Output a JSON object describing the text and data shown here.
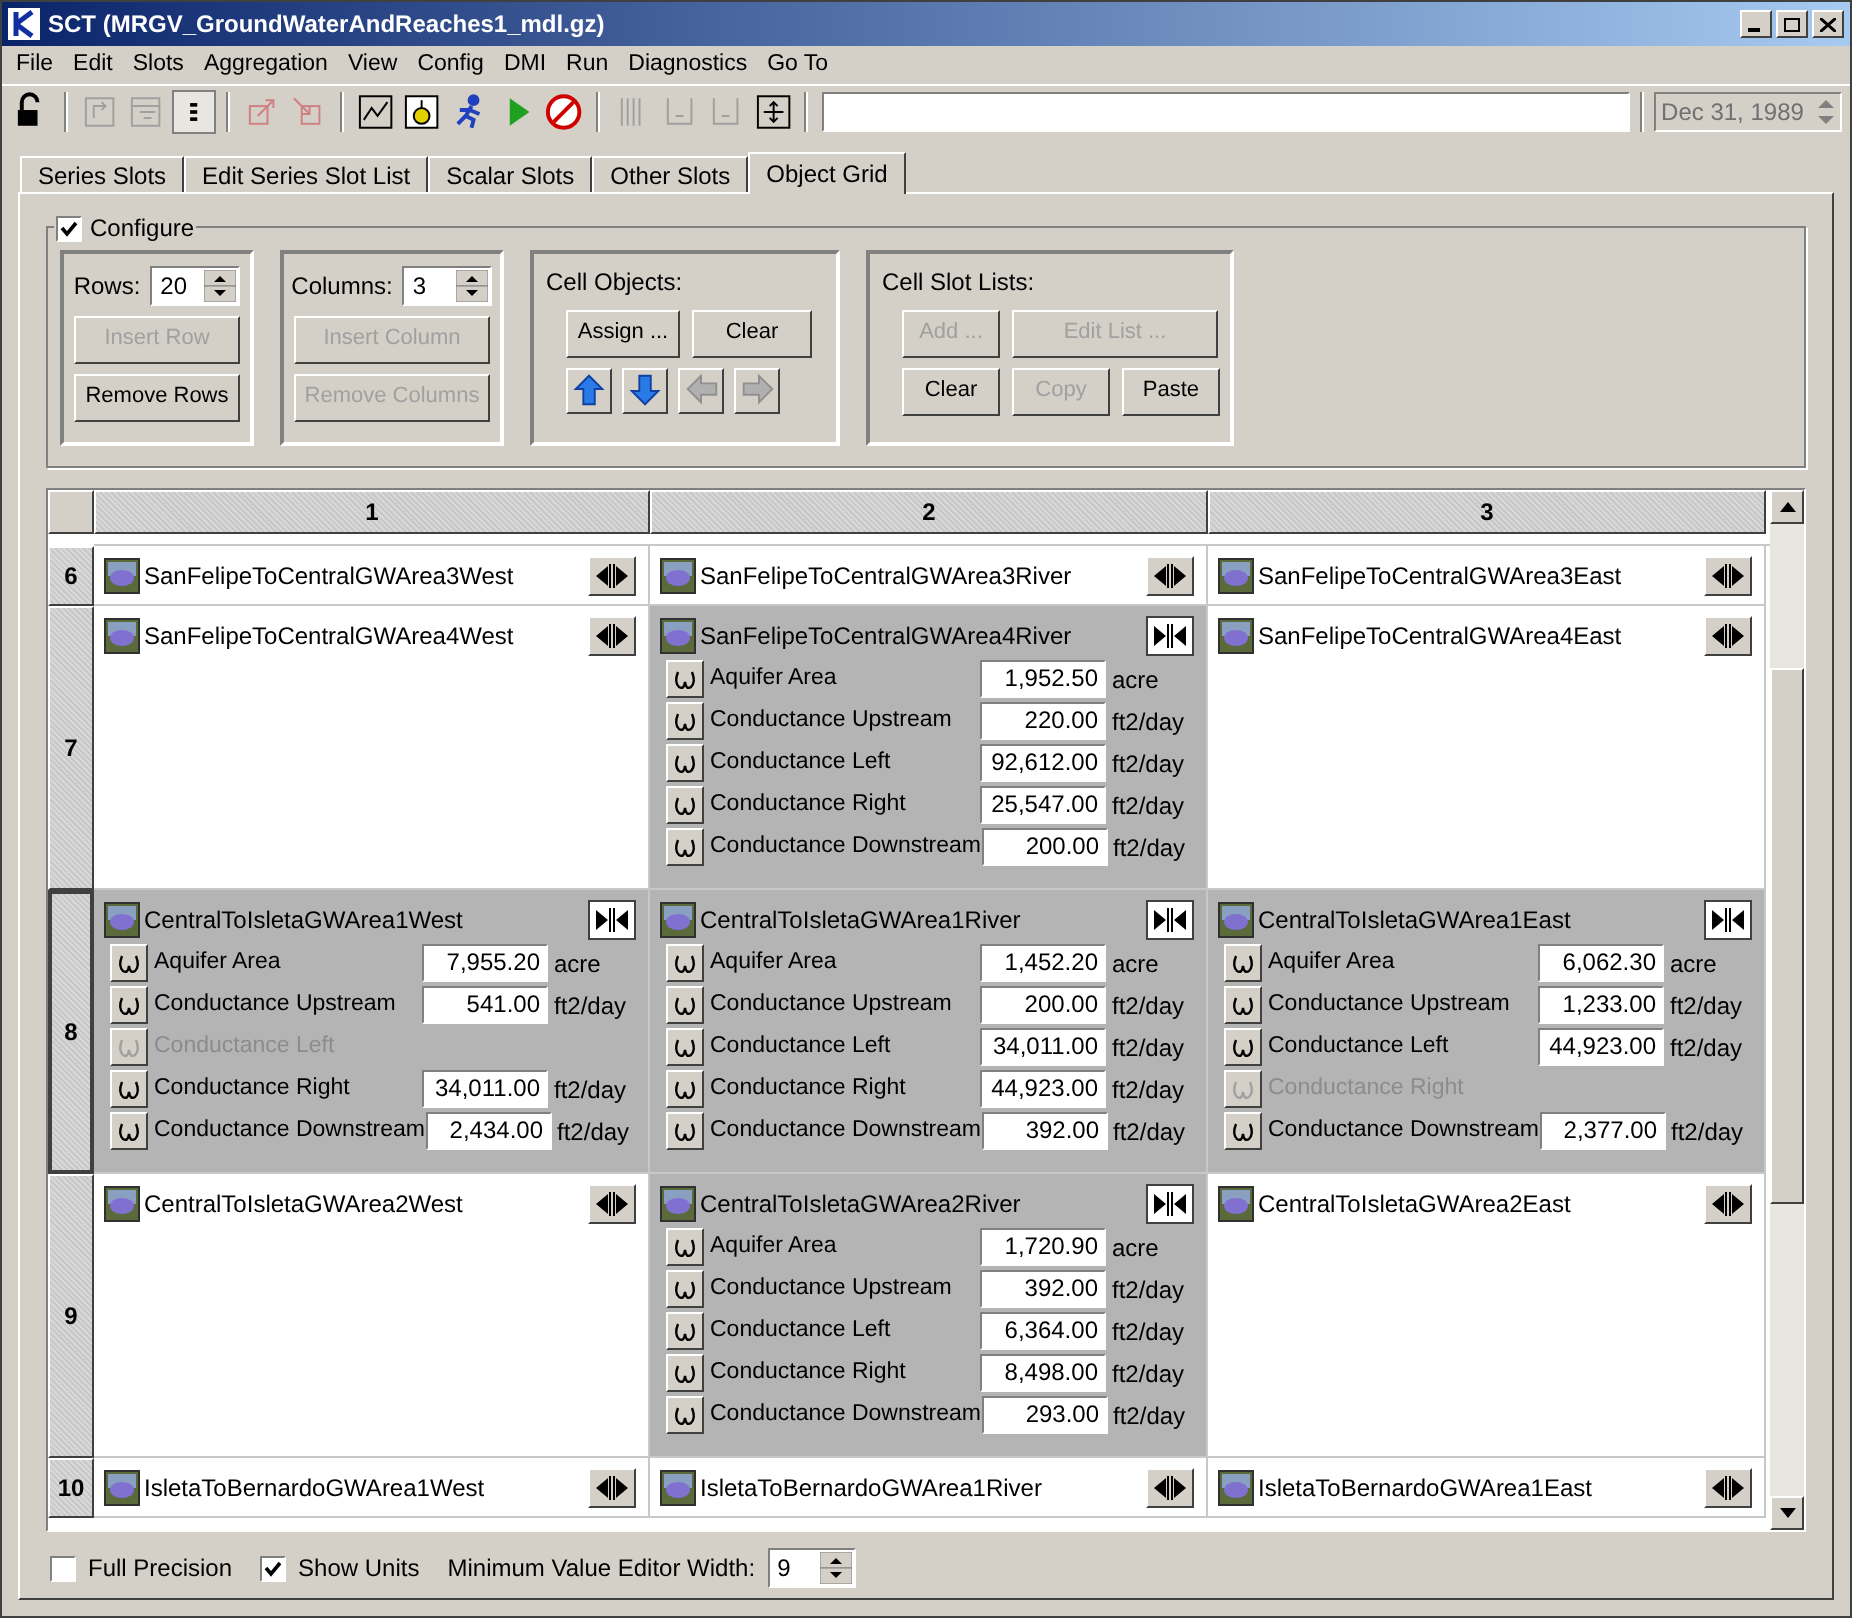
{
  "window": {
    "title": "SCT  (MRGV_GroundWaterAndReaches1_mdl.gz)"
  },
  "menu": [
    "File",
    "Edit",
    "Slots",
    "Aggregation",
    "View",
    "Config",
    "DMI",
    "Run",
    "Diagnostics",
    "Go To"
  ],
  "toolbar": [
    {
      "kind": "lock",
      "disabled": false
    },
    {
      "kind": "sep"
    },
    {
      "kind": "swap",
      "disabled": true
    },
    {
      "kind": "filter",
      "disabled": true
    },
    {
      "kind": "list",
      "disabled": false,
      "pressed": true
    },
    {
      "kind": "sep"
    },
    {
      "kind": "export",
      "disabled": true
    },
    {
      "kind": "import",
      "disabled": true
    },
    {
      "kind": "sep"
    },
    {
      "kind": "plot",
      "disabled": false
    },
    {
      "kind": "debug",
      "disabled": false
    },
    {
      "kind": "runner",
      "disabled": false
    },
    {
      "kind": "play",
      "disabled": false
    },
    {
      "kind": "stop",
      "disabled": false
    },
    {
      "kind": "sep"
    },
    {
      "kind": "bars",
      "disabled": true
    },
    {
      "kind": "bracket",
      "disabled": true
    },
    {
      "kind": "bracket",
      "disabled": true
    },
    {
      "kind": "fit",
      "disabled": false
    },
    {
      "kind": "sep"
    }
  ],
  "date_field": {
    "value": "Dec 31, 1989",
    "disabled": true
  },
  "tabs": [
    {
      "label": "Series Slots",
      "selected": false
    },
    {
      "label": "Edit Series Slot List",
      "selected": false
    },
    {
      "label": "Scalar Slots",
      "selected": false
    },
    {
      "label": "Other Slots",
      "selected": false
    },
    {
      "label": "Object Grid",
      "selected": true
    }
  ],
  "configure": {
    "label": "Configure",
    "checked": true,
    "rows_group": {
      "label": "Rows:",
      "value": "20",
      "buttons": [
        {
          "label": "Insert Row",
          "disabled": true
        },
        {
          "label": "Remove Rows",
          "disabled": false
        }
      ]
    },
    "columns_group": {
      "label": "Columns:",
      "value": "3",
      "buttons": [
        {
          "label": "Insert Column",
          "disabled": true
        },
        {
          "label": "Remove Columns",
          "disabled": true
        }
      ]
    },
    "cell_objects": {
      "title": "Cell Objects:",
      "buttons": [
        {
          "label": "Assign ...",
          "disabled": false
        },
        {
          "label": "Clear",
          "disabled": false
        }
      ],
      "arrows": [
        {
          "kind": "up",
          "disabled": false
        },
        {
          "kind": "down",
          "disabled": false
        },
        {
          "kind": "left",
          "disabled": true
        },
        {
          "kind": "right",
          "disabled": true
        }
      ]
    },
    "cell_slot_lists": {
      "title": "Cell Slot Lists:",
      "buttons": [
        {
          "label": "Add ...",
          "disabled": true
        },
        {
          "label": "Edit List ...",
          "disabled": true
        },
        {
          "label": "Clear",
          "disabled": false
        },
        {
          "label": "Copy",
          "disabled": true
        },
        {
          "label": "Paste",
          "disabled": false
        }
      ]
    }
  },
  "grid": {
    "columns": [
      "1",
      "2",
      "3"
    ],
    "rows": [
      {
        "label": "6",
        "selected": false,
        "cells": [
          {
            "name": "SanFelipeToCentralGWArea3West",
            "expanded": false
          },
          {
            "name": "SanFelipeToCentralGWArea3River",
            "expanded": false
          },
          {
            "name": "SanFelipeToCentralGWArea3East",
            "expanded": false
          }
        ]
      },
      {
        "label": "7",
        "selected": false,
        "cells": [
          {
            "name": "SanFelipeToCentralGWArea4West",
            "expanded": false
          },
          {
            "name": "SanFelipeToCentralGWArea4River",
            "expanded": true,
            "slots": [
              {
                "name": "Aquifer Area",
                "value": "1,952.50",
                "unit": "acre",
                "disabled": false
              },
              {
                "name": "Conductance Upstream",
                "value": "220.00",
                "unit": "ft2/day",
                "disabled": false
              },
              {
                "name": "Conductance Left",
                "value": "92,612.00",
                "unit": "ft2/day",
                "disabled": false
              },
              {
                "name": "Conductance Right",
                "value": "25,547.00",
                "unit": "ft2/day",
                "disabled": false
              },
              {
                "name": "Conductance Downstream",
                "value": "200.00",
                "unit": "ft2/day",
                "disabled": false
              }
            ]
          },
          {
            "name": "SanFelipeToCentralGWArea4East",
            "expanded": false
          }
        ]
      },
      {
        "label": "8",
        "selected": true,
        "cells": [
          {
            "name": "CentralToIsletaGWArea1West",
            "expanded": true,
            "slots": [
              {
                "name": "Aquifer Area",
                "value": "7,955.20",
                "unit": "acre",
                "disabled": false
              },
              {
                "name": "Conductance Upstream",
                "value": "541.00",
                "unit": "ft2/day",
                "disabled": false
              },
              {
                "name": "Conductance Left",
                "disabled": true
              },
              {
                "name": "Conductance Right",
                "value": "34,011.00",
                "unit": "ft2/day",
                "disabled": false
              },
              {
                "name": "Conductance Downstream",
                "value": "2,434.00",
                "unit": "ft2/day",
                "disabled": false
              }
            ]
          },
          {
            "name": "CentralToIsletaGWArea1River",
            "expanded": true,
            "slots": [
              {
                "name": "Aquifer Area",
                "value": "1,452.20",
                "unit": "acre",
                "disabled": false
              },
              {
                "name": "Conductance Upstream",
                "value": "200.00",
                "unit": "ft2/day",
                "disabled": false
              },
              {
                "name": "Conductance Left",
                "value": "34,011.00",
                "unit": "ft2/day",
                "disabled": false
              },
              {
                "name": "Conductance Right",
                "value": "44,923.00",
                "unit": "ft2/day",
                "disabled": false
              },
              {
                "name": "Conductance Downstream",
                "value": "392.00",
                "unit": "ft2/day",
                "disabled": false
              }
            ]
          },
          {
            "name": "CentralToIsletaGWArea1East",
            "expanded": true,
            "slots": [
              {
                "name": "Aquifer Area",
                "value": "6,062.30",
                "unit": "acre",
                "disabled": false
              },
              {
                "name": "Conductance Upstream",
                "value": "1,233.00",
                "unit": "ft2/day",
                "disabled": false
              },
              {
                "name": "Conductance Left",
                "value": "44,923.00",
                "unit": "ft2/day",
                "disabled": false
              },
              {
                "name": "Conductance Right",
                "disabled": true
              },
              {
                "name": "Conductance Downstream",
                "value": "2,377.00",
                "unit": "ft2/day",
                "disabled": false
              }
            ]
          }
        ]
      },
      {
        "label": "9",
        "selected": false,
        "cells": [
          {
            "name": "CentralToIsletaGWArea2West",
            "expanded": false
          },
          {
            "name": "CentralToIsletaGWArea2River",
            "expanded": true,
            "slots": [
              {
                "name": "Aquifer Area",
                "value": "1,720.90",
                "unit": "acre",
                "disabled": false
              },
              {
                "name": "Conductance Upstream",
                "value": "392.00",
                "unit": "ft2/day",
                "disabled": false
              },
              {
                "name": "Conductance Left",
                "value": "6,364.00",
                "unit": "ft2/day",
                "disabled": false
              },
              {
                "name": "Conductance Right",
                "value": "8,498.00",
                "unit": "ft2/day",
                "disabled": false
              },
              {
                "name": "Conductance Downstream",
                "value": "293.00",
                "unit": "ft2/day",
                "disabled": false
              }
            ]
          },
          {
            "name": "CentralToIsletaGWArea2East",
            "expanded": false
          }
        ]
      },
      {
        "label": "10",
        "selected": false,
        "cells": [
          {
            "name": "IsletaToBernardoGWArea1West",
            "expanded": false
          },
          {
            "name": "IsletaToBernardoGWArea1River",
            "expanded": false
          },
          {
            "name": "IsletaToBernardoGWArea1East",
            "expanded": false
          }
        ]
      }
    ]
  },
  "options": {
    "full_precision": {
      "label": "Full Precision",
      "checked": false
    },
    "show_units": {
      "label": "Show Units",
      "checked": true
    },
    "min_width": {
      "label": "Minimum Value Editor Width:",
      "value": "9"
    }
  }
}
